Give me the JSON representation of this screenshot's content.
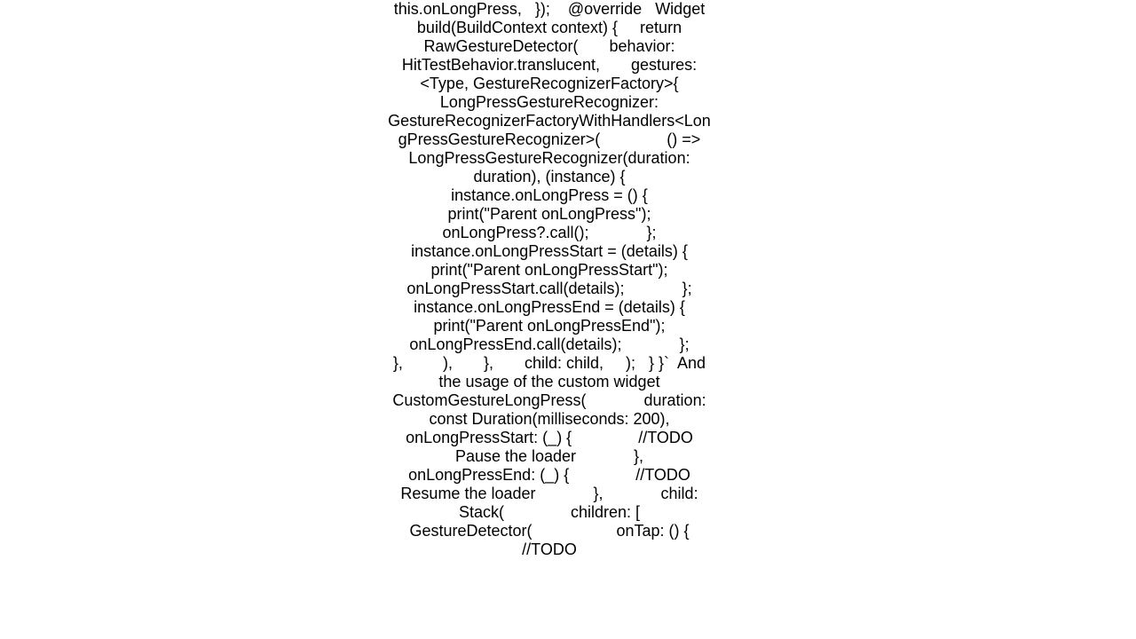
{
  "content": {
    "codeText": "this.onLongPress,   });    @override   Widget build(BuildContext context) {     return RawGestureDetector(       behavior: HitTestBehavior.translucent,       gestures: <Type, GestureRecognizerFactory>{         LongPressGestureRecognizer: GestureRecognizerFactoryWithHandlers<LongPressGestureRecognizer>(               () => LongPressGestureRecognizer(duration: duration), (instance) {             instance.onLongPress = () {               print(\"Parent onLongPress\");               onLongPress?.call();             };             instance.onLongPressStart = (details) {               print(\"Parent onLongPressStart\");               onLongPressStart.call(details);             };             instance.onLongPressEnd = (details) {               print(\"Parent onLongPressEnd\");               onLongPressEnd.call(details);             };           },         ),       },       child: child,     );   } }`  And the usage of the custom widget  CustomGestureLongPress(             duration: const Duration(milliseconds: 200),             onLongPressStart: (_) {               //TODO Pause the loader             },             onLongPressEnd: (_) {               //TODO Resume the loader             },             child: Stack(               children: [                 GestureDetector(                   onTap: () {                     //TODO"
  }
}
